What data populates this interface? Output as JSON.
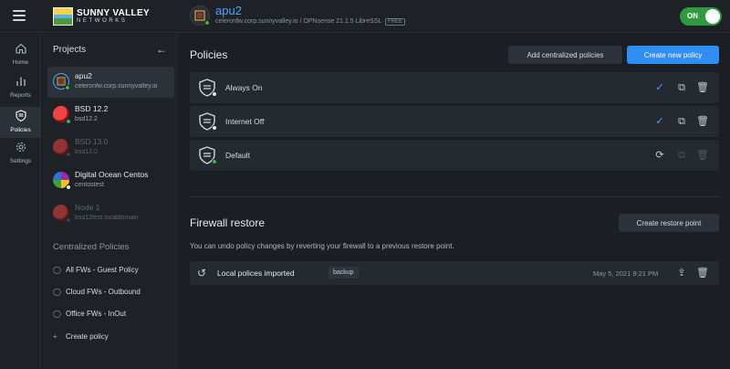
{
  "app": {
    "logo_line1": "SUNNY VALLEY",
    "logo_line2": "NETWORKS"
  },
  "device": {
    "name": "apu2",
    "host": "celeronfw.corp.sunnyvalley.io",
    "separator": "/",
    "version": "OPNsense 21.1.5 LibreSSL",
    "badge": "FREE",
    "status_color": "#38b44a"
  },
  "toggle": {
    "label": "ON",
    "state": "on",
    "color": "#2f9a3e"
  },
  "rail": [
    {
      "label": "Home",
      "icon": "home-icon"
    },
    {
      "label": "Reports",
      "icon": "bar-chart-icon"
    },
    {
      "label": "Policies",
      "icon": "shield-icon",
      "active": true
    },
    {
      "label": "Settings",
      "icon": "gear-icon"
    }
  ],
  "projects": {
    "title": "Projects",
    "items": [
      {
        "name": "apu2",
        "sub": "celeronfw.corp.sunnyvalley.io",
        "status": "online"
      },
      {
        "name": "BSD 12.2",
        "sub": "bsd12.2",
        "status": "online"
      },
      {
        "name": "BSD 13.0",
        "sub": "bsd13.0",
        "status": "offline"
      },
      {
        "name": "Digital Ocean Centos",
        "sub": "centostest",
        "status": "idle"
      },
      {
        "name": "Node 1",
        "sub": "bsd12test.localdomain",
        "status": "offline"
      }
    ]
  },
  "centralized": {
    "title": "Centralized Policies",
    "items": [
      {
        "label": "All FWs - Guest Policy"
      },
      {
        "label": "Cloud FWs - Outbound"
      },
      {
        "label": "Office FWs - InOut"
      }
    ],
    "create_label": "Create policy"
  },
  "policies": {
    "title": "Policies",
    "add_centralized_label": "Add centralized policies",
    "create_new_label": "Create new policy",
    "rows": [
      {
        "name": "Always On",
        "status": "active",
        "primary_action": "check-circle-icon"
      },
      {
        "name": "Internet Off",
        "status": "inactive",
        "primary_action": "check-circle-icon"
      },
      {
        "name": "Default",
        "status": "active",
        "primary_action": "sync-icon"
      }
    ]
  },
  "firewall_restore": {
    "title": "Firewall restore",
    "create_restore_label": "Create restore point",
    "description": "You can undo policy changes by reverting your firewall to a previous restore point.",
    "rows": [
      {
        "name": "Local polices imported",
        "tag": "backup",
        "date": "May 5, 2021 9:21 PM"
      }
    ]
  },
  "colors": {
    "accent": "#2f8ef4",
    "online": "#38b44a",
    "background": "#1b1f24"
  }
}
